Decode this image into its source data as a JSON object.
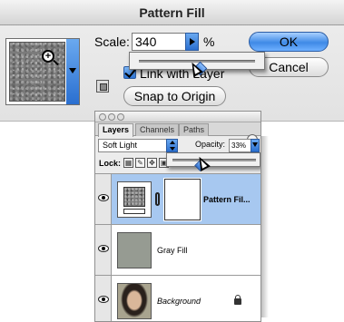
{
  "dialog": {
    "title": "Pattern Fill",
    "scale_label": "Scale:",
    "scale_value": "340",
    "scale_unit": "%",
    "link_with_layer_label": "Link with Layer",
    "link_with_layer_checked": true,
    "ok_label": "OK",
    "cancel_label": "Cancel",
    "snap_label": "Snap to Origin",
    "scale_slider_level": 0.52,
    "pattern_picker_icon": "zoom-in-cursor-icon",
    "new_preset_icon": "new-preset-icon"
  },
  "layers_panel": {
    "tabs": [
      {
        "label": "Layers",
        "active": true
      },
      {
        "label": "Channels",
        "active": false
      },
      {
        "label": "Paths",
        "active": false
      }
    ],
    "blend_mode": "Soft Light",
    "opacity_label": "Opacity:",
    "opacity_value": "33%",
    "opacity_slider_level": 0.33,
    "lock_label": "Lock:",
    "lock_icons": [
      "lock-transparency-icon",
      "lock-image-icon",
      "lock-position-icon",
      "lock-all-icon"
    ],
    "layers": [
      {
        "name": "Pattern Fil...",
        "selected": true,
        "visible": true,
        "has_mask": true,
        "style": "bold"
      },
      {
        "name": "Gray Fill",
        "selected": false,
        "visible": true,
        "has_mask": false,
        "style": "normal"
      },
      {
        "name": "Background",
        "selected": false,
        "visible": true,
        "has_mask": false,
        "style": "italic",
        "locked": true
      }
    ]
  },
  "colors": {
    "aqua_blue": "#3f8ae6",
    "selected_row": "#a7c8f0",
    "gray_fill": "#969b92"
  }
}
